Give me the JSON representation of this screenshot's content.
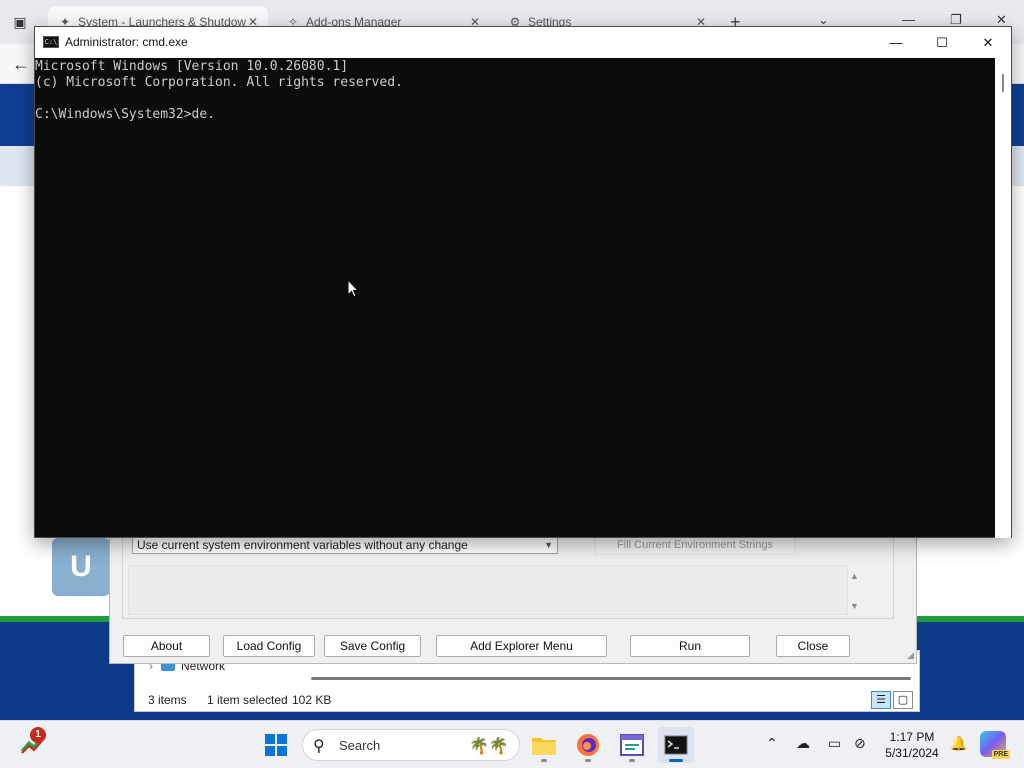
{
  "browser": {
    "tabs": [
      {
        "label": "System - Launchers & Shutdow",
        "icon": "puzzle-icon",
        "active": true
      },
      {
        "label": "Add-ons Manager",
        "icon": "puzzle-icon",
        "active": false
      },
      {
        "label": "Settings",
        "icon": "gear-icon",
        "active": false
      }
    ]
  },
  "launcher": {
    "env_select": "Use current system environment variables without any change",
    "fill_button": "Fill Current Environment Strings",
    "buttons": {
      "about": "About",
      "load_config": "Load Config",
      "save_config": "Save Config",
      "add_explorer_menu": "Add Explorer Menu",
      "run": "Run",
      "close": "Close"
    }
  },
  "explorer": {
    "nav_item": "Network",
    "status": {
      "items": "3 items",
      "selected": "1 item selected",
      "size": "102 KB"
    }
  },
  "cmd": {
    "title": "Administrator: cmd.exe",
    "lines": [
      "Microsoft Windows [Version 10.0.26080.1]",
      "(c) Microsoft Corporation. All rights reserved.",
      "",
      "C:\\Windows\\System32>de."
    ]
  },
  "taskbar": {
    "widget_badge": "1",
    "search_label": "Search",
    "clock": {
      "time": "1:17 PM",
      "date": "5/31/2024"
    },
    "copilot_badge": "PRE"
  },
  "colors": {
    "page_header": "#0f3e93",
    "page_band": "#0e3a8a",
    "band_stripe": "#1e9c3d",
    "console_bg": "#0c0c0c",
    "console_text": "#cccccc",
    "accent": "#0067c0"
  }
}
